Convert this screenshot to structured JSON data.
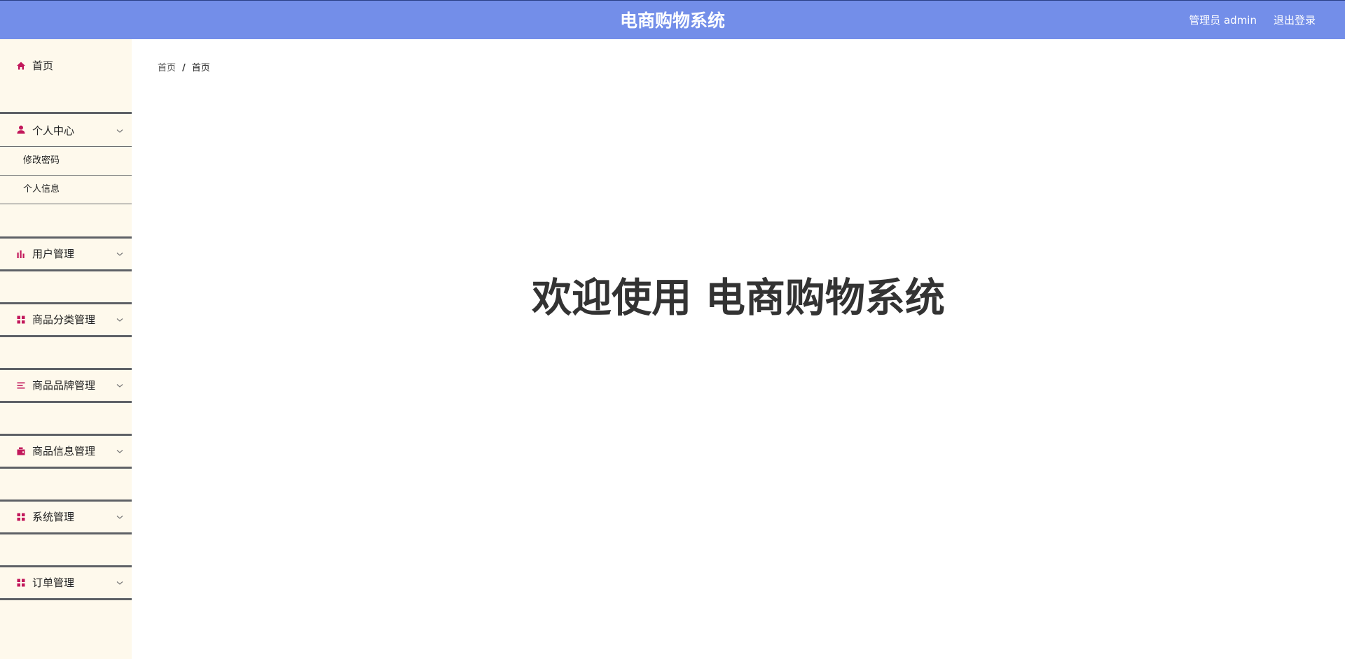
{
  "header": {
    "title": "电商购物系统",
    "user_info": "管理员 admin",
    "logout_label": "退出登录"
  },
  "sidebar": {
    "home": {
      "label": "首页",
      "icon": "home-icon"
    },
    "menus": [
      {
        "label": "个人中心",
        "icon": "user-icon",
        "expanded": true,
        "children": [
          {
            "label": "修改密码"
          },
          {
            "label": "个人信息"
          }
        ]
      },
      {
        "label": "用户管理",
        "icon": "bar-chart-icon",
        "expanded": false
      },
      {
        "label": "商品分类管理",
        "icon": "grid-icon",
        "expanded": false
      },
      {
        "label": "商品品牌管理",
        "icon": "list-icon",
        "expanded": false
      },
      {
        "label": "商品信息管理",
        "icon": "wallet-icon",
        "expanded": false
      },
      {
        "label": "系统管理",
        "icon": "grid-icon",
        "expanded": false
      },
      {
        "label": "订单管理",
        "icon": "grid-icon",
        "expanded": false
      }
    ]
  },
  "breadcrumb": {
    "root": "首页",
    "separator": "/",
    "current": "首页"
  },
  "main": {
    "welcome": "欢迎使用 电商购物系统"
  },
  "colors": {
    "header_bg": "#738ee9",
    "sidebar_bg": "#fef9ec",
    "icon_accent": "#c2185b",
    "divider": "#5e6166"
  }
}
